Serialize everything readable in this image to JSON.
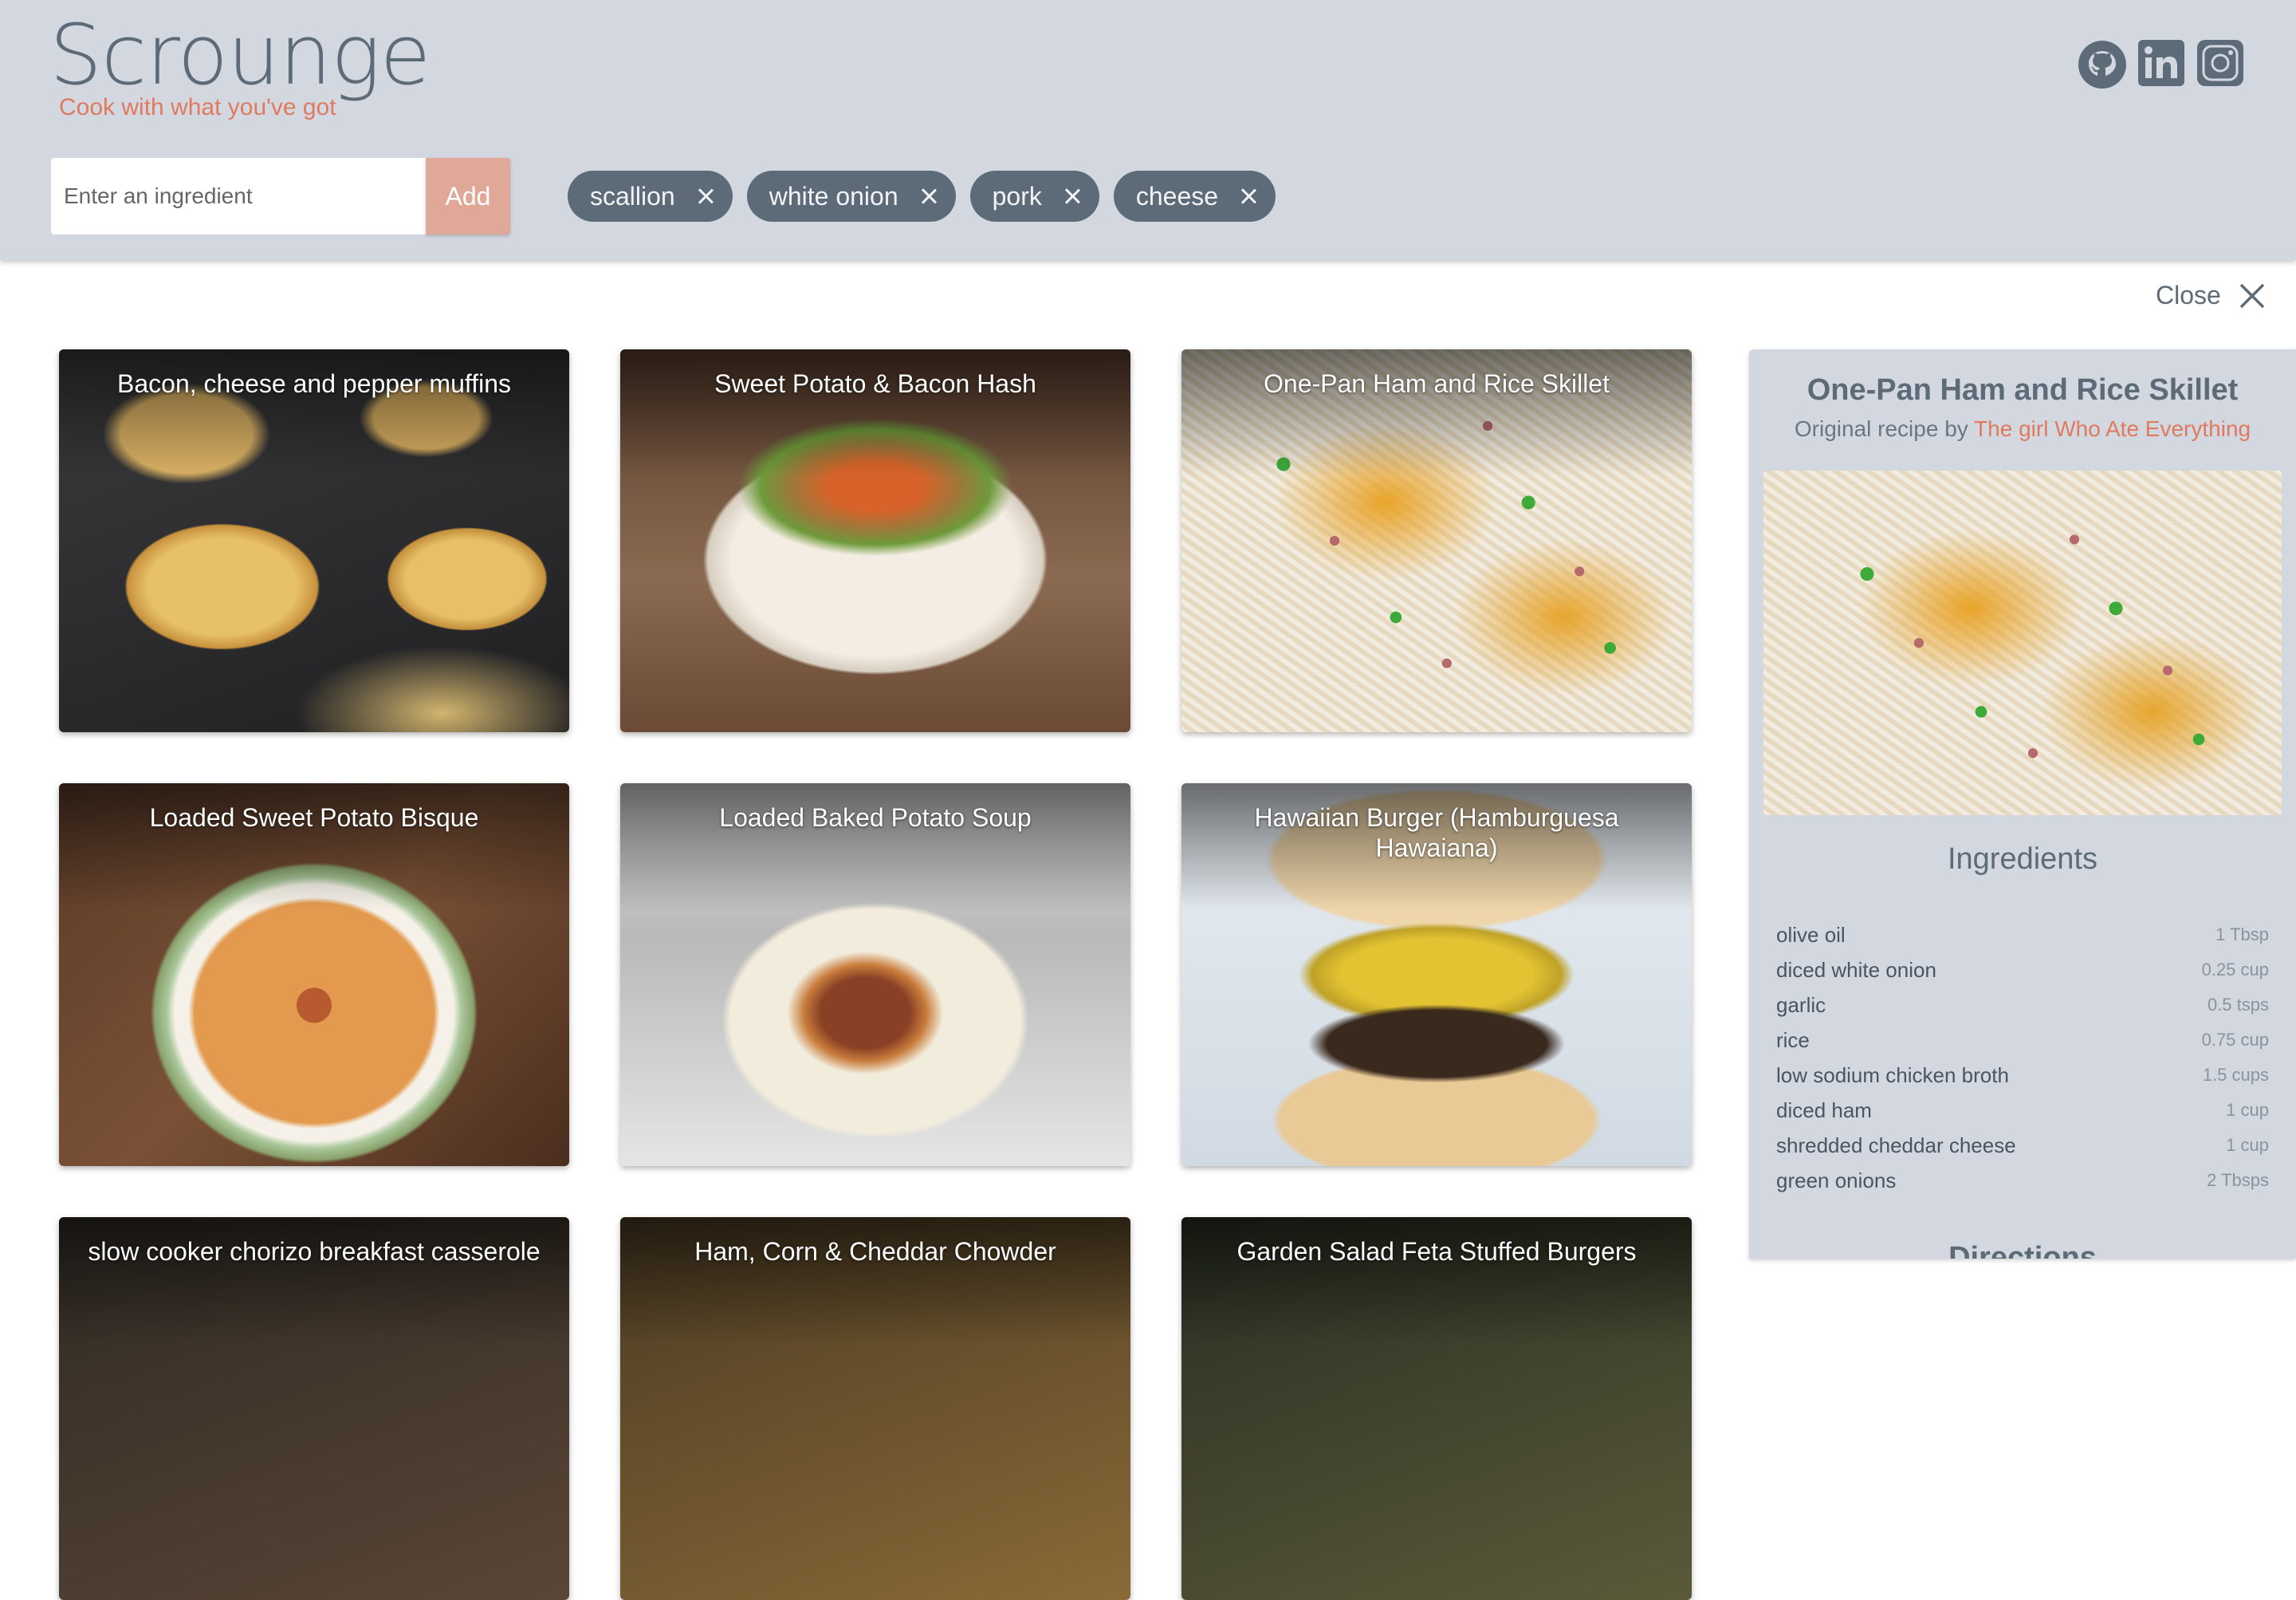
{
  "header": {
    "logo": "Scrounge",
    "tagline": "Cook with what you've got",
    "input_placeholder": "Enter an ingredient",
    "add_label": "Add",
    "chips": [
      "scallion",
      "white onion",
      "pork",
      "cheese"
    ],
    "social_icons": [
      "github-icon",
      "linkedin-icon",
      "instagram-icon"
    ]
  },
  "close_label": "Close",
  "recipes": [
    "Bacon, cheese and pepper muffins",
    "Sweet Potato & Bacon Hash",
    "One-Pan Ham and Rice Skillet",
    "Loaded Sweet Potato Bisque",
    "Loaded Baked Potato Soup",
    "Hawaiian Burger (Hamburguesa Hawaiana)",
    "slow cooker chorizo breakfast casserole",
    "Ham, Corn & Cheddar Chowder",
    "Garden Salad Feta Stuffed Burgers"
  ],
  "detail": {
    "title": "One-Pan Ham and Rice Skillet",
    "byline_prefix": "Original recipe by",
    "source": "The girl Who Ate Everything",
    "ingredients_heading": "Ingredients",
    "ingredients": [
      {
        "name": "olive oil",
        "qty": "1 Tbsp"
      },
      {
        "name": "diced white onion",
        "qty": "0.25 cup"
      },
      {
        "name": "garlic",
        "qty": "0.5 tsps"
      },
      {
        "name": "rice",
        "qty": "0.75 cup"
      },
      {
        "name": "low sodium chicken broth",
        "qty": "1.5 cups"
      },
      {
        "name": "diced ham",
        "qty": "1 cup"
      },
      {
        "name": "shredded cheddar cheese",
        "qty": "1 cup"
      },
      {
        "name": "green onions",
        "qty": "2 Tbsps"
      }
    ],
    "directions_heading": "Directions"
  },
  "colors": {
    "header_bg": "#d3d8e0",
    "slate": "#5d6b78",
    "accent": "#e07a5f",
    "add_button": "#e0a899"
  }
}
